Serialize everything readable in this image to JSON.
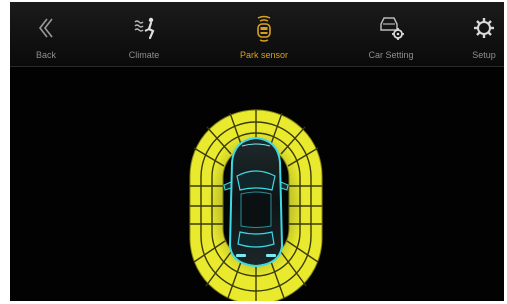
{
  "topbar": {
    "items": [
      {
        "label": "Back",
        "icon": "back-chevron-icon"
      },
      {
        "label": "Climate",
        "icon": "climate-airflow-icon"
      },
      {
        "label": "Park sensor",
        "icon": "park-sensor-icon",
        "active": true
      },
      {
        "label": "Car Setting",
        "icon": "car-settings-icon"
      },
      {
        "label": "Setup",
        "icon": "gear-icon"
      }
    ]
  },
  "park_sensor": {
    "car_icon": "car-top-view-icon",
    "zones": [
      "front",
      "left",
      "right",
      "rear"
    ]
  },
  "colors": {
    "background": "#020202",
    "topbar": "#141414",
    "label_inactive": "#8e8e8e",
    "label_active": "#d9a020",
    "sensor_segment": "#e9ea2e",
    "sensor_outline": "#8a8a15",
    "car_glow": "#3fd9e4"
  }
}
